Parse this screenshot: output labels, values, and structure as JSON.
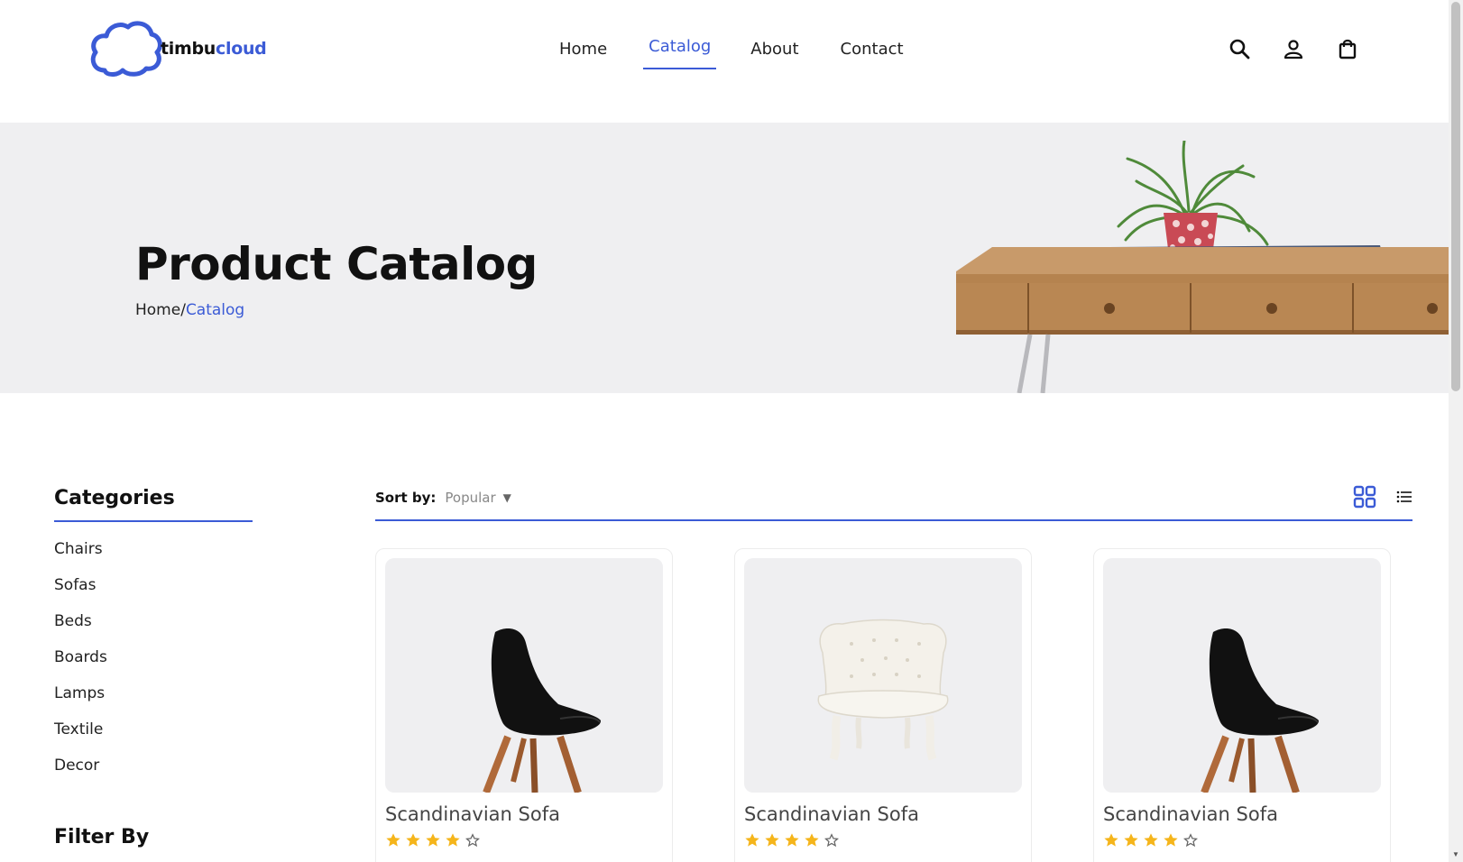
{
  "brand": {
    "part1": "timbu",
    "part2": "cloud",
    "accent": "#3b5bd6"
  },
  "nav": [
    {
      "label": "Home",
      "active": false
    },
    {
      "label": "Catalog",
      "active": true
    },
    {
      "label": "About",
      "active": false
    },
    {
      "label": "Contact",
      "active": false
    }
  ],
  "header_icons": [
    "search-icon",
    "user-icon",
    "shopping-bag-icon"
  ],
  "hero": {
    "title": "Product Catalog",
    "breadcrumb": {
      "home": "Home",
      "separator": "/",
      "current": "Catalog"
    }
  },
  "sidebar": {
    "categories_heading": "Categories",
    "categories": [
      "Chairs",
      "Sofas",
      "Beds",
      "Boards",
      "Lamps",
      "Textile",
      "Decor"
    ],
    "filter_heading": "Filter By"
  },
  "toolbar": {
    "sort_label": "Sort by:",
    "sort_value": "Popular",
    "views": [
      "grid-view-icon",
      "list-view-icon"
    ]
  },
  "products": [
    {
      "name": "Scandinavian Sofa",
      "rating": 4,
      "max_rating": 5,
      "image": "black-chair"
    },
    {
      "name": "Scandinavian Sofa",
      "rating": 4,
      "max_rating": 5,
      "image": "white-armchair"
    },
    {
      "name": "Scandinavian Sofa",
      "rating": 4,
      "max_rating": 5,
      "image": "black-chair"
    }
  ],
  "colors": {
    "accent": "#3b5bd6",
    "star": "#f5b51b",
    "hero_bg": "#efeff1"
  }
}
